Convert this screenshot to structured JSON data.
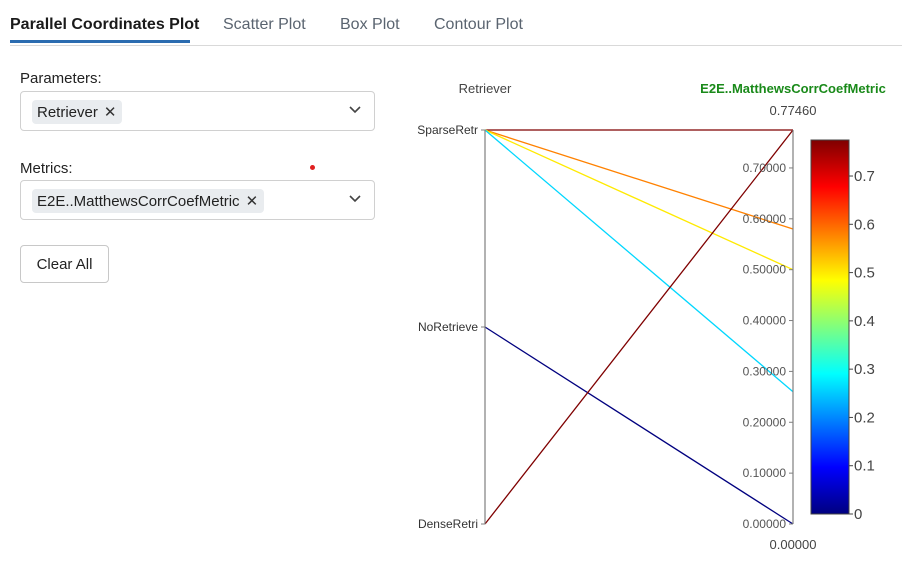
{
  "tabs": [
    {
      "label": "Parallel Coordinates Plot",
      "active": true
    },
    {
      "label": "Scatter Plot",
      "active": false
    },
    {
      "label": "Box Plot",
      "active": false
    },
    {
      "label": "Contour Plot",
      "active": false
    }
  ],
  "parameters": {
    "label": "Parameters:",
    "selected": "Retriever"
  },
  "metrics": {
    "label": "Metrics:",
    "selected": "E2E..MatthewsCorrCoefMetric"
  },
  "clear_all_label": "Clear All",
  "colors": {
    "accent": "#2b6cb0",
    "metric_title": "#1a8a1a",
    "axis": "#7f7f7f"
  },
  "chart_data": {
    "type": "parallel_coordinates",
    "colorscale": "jet",
    "dimensions": [
      {
        "label": "Retriever",
        "type": "categorical",
        "categories": [
          "DenseRetri",
          "NoRetrieve",
          "SparseRetr"
        ]
      },
      {
        "label": "E2E..MatthewsCorrCoefMetric",
        "type": "numeric",
        "range": [
          0.0,
          0.7746
        ],
        "top_label": "0.77460",
        "bottom_label": "0.00000",
        "ticks": [
          "0.00000",
          "0.10000",
          "0.20000",
          "0.30000",
          "0.40000",
          "0.50000",
          "0.60000",
          "0.70000"
        ],
        "tick_values": [
          0.0,
          0.1,
          0.2,
          0.3,
          0.4,
          0.5,
          0.6,
          0.7
        ]
      }
    ],
    "lines": [
      {
        "Retriever": "SparseRetr",
        "value": 0.7746
      },
      {
        "Retriever": "SparseRetr",
        "value": 0.58
      },
      {
        "Retriever": "SparseRetr",
        "value": 0.5
      },
      {
        "Retriever": "SparseRetr",
        "value": 0.26
      },
      {
        "Retriever": "NoRetrieve",
        "value": 0.0
      },
      {
        "Retriever": "DenseRetri",
        "value": 0.7746
      }
    ],
    "colorbar": {
      "range": [
        0,
        0.7746
      ],
      "ticks": [
        "0",
        "0.1",
        "0.2",
        "0.3",
        "0.4",
        "0.5",
        "0.6",
        "0.7"
      ],
      "tick_values": [
        0,
        0.1,
        0.2,
        0.3,
        0.4,
        0.5,
        0.6,
        0.7
      ]
    }
  }
}
